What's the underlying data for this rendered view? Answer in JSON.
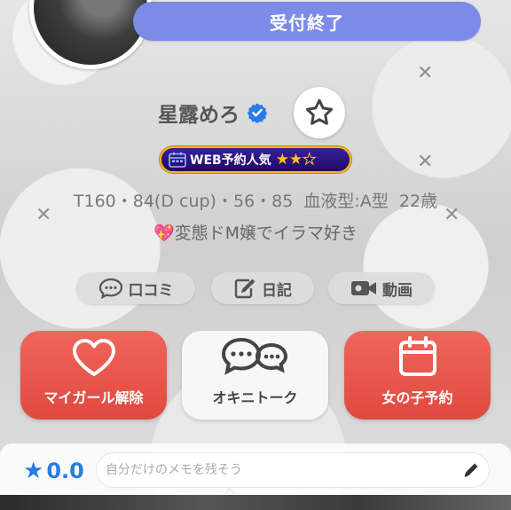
{
  "status": {
    "label": "受付終了"
  },
  "profile": {
    "name": "星露めろ",
    "stats": "T160・84(D cup)・56・85",
    "blood": "血液型:A型",
    "age": "22歳",
    "catch_emoji": "💖",
    "catch": "変態ドM嬢でイラマ好き"
  },
  "badge": {
    "label": "WEB予約人気",
    "stars_filled": "★★",
    "stars_empty": "★",
    "rating": 2,
    "max": 3
  },
  "tabs": [
    {
      "label": "口コミ"
    },
    {
      "label": "日記"
    },
    {
      "label": "動画"
    }
  ],
  "actions": {
    "my_girl": "マイガール解除",
    "talk": "オキニトーク",
    "reserve": "女の子予約"
  },
  "memo": {
    "rating": "0.0",
    "placeholder": "自分だけのメモを残そう"
  },
  "colors": {
    "accent_blue": "#2a7be4",
    "status_bar": "#7d8be8",
    "action_red": "#e8554a"
  },
  "icons": {
    "verified": "verified-check-icon",
    "favorite": "star-outline-icon",
    "review": "chat-bubble-icon",
    "diary": "edit-note-icon",
    "video": "video-camera-icon",
    "heart": "heart-outline-icon",
    "talk": "chat-bubbles-icon",
    "calendar": "calendar-icon",
    "pencil": "pencil-icon"
  }
}
